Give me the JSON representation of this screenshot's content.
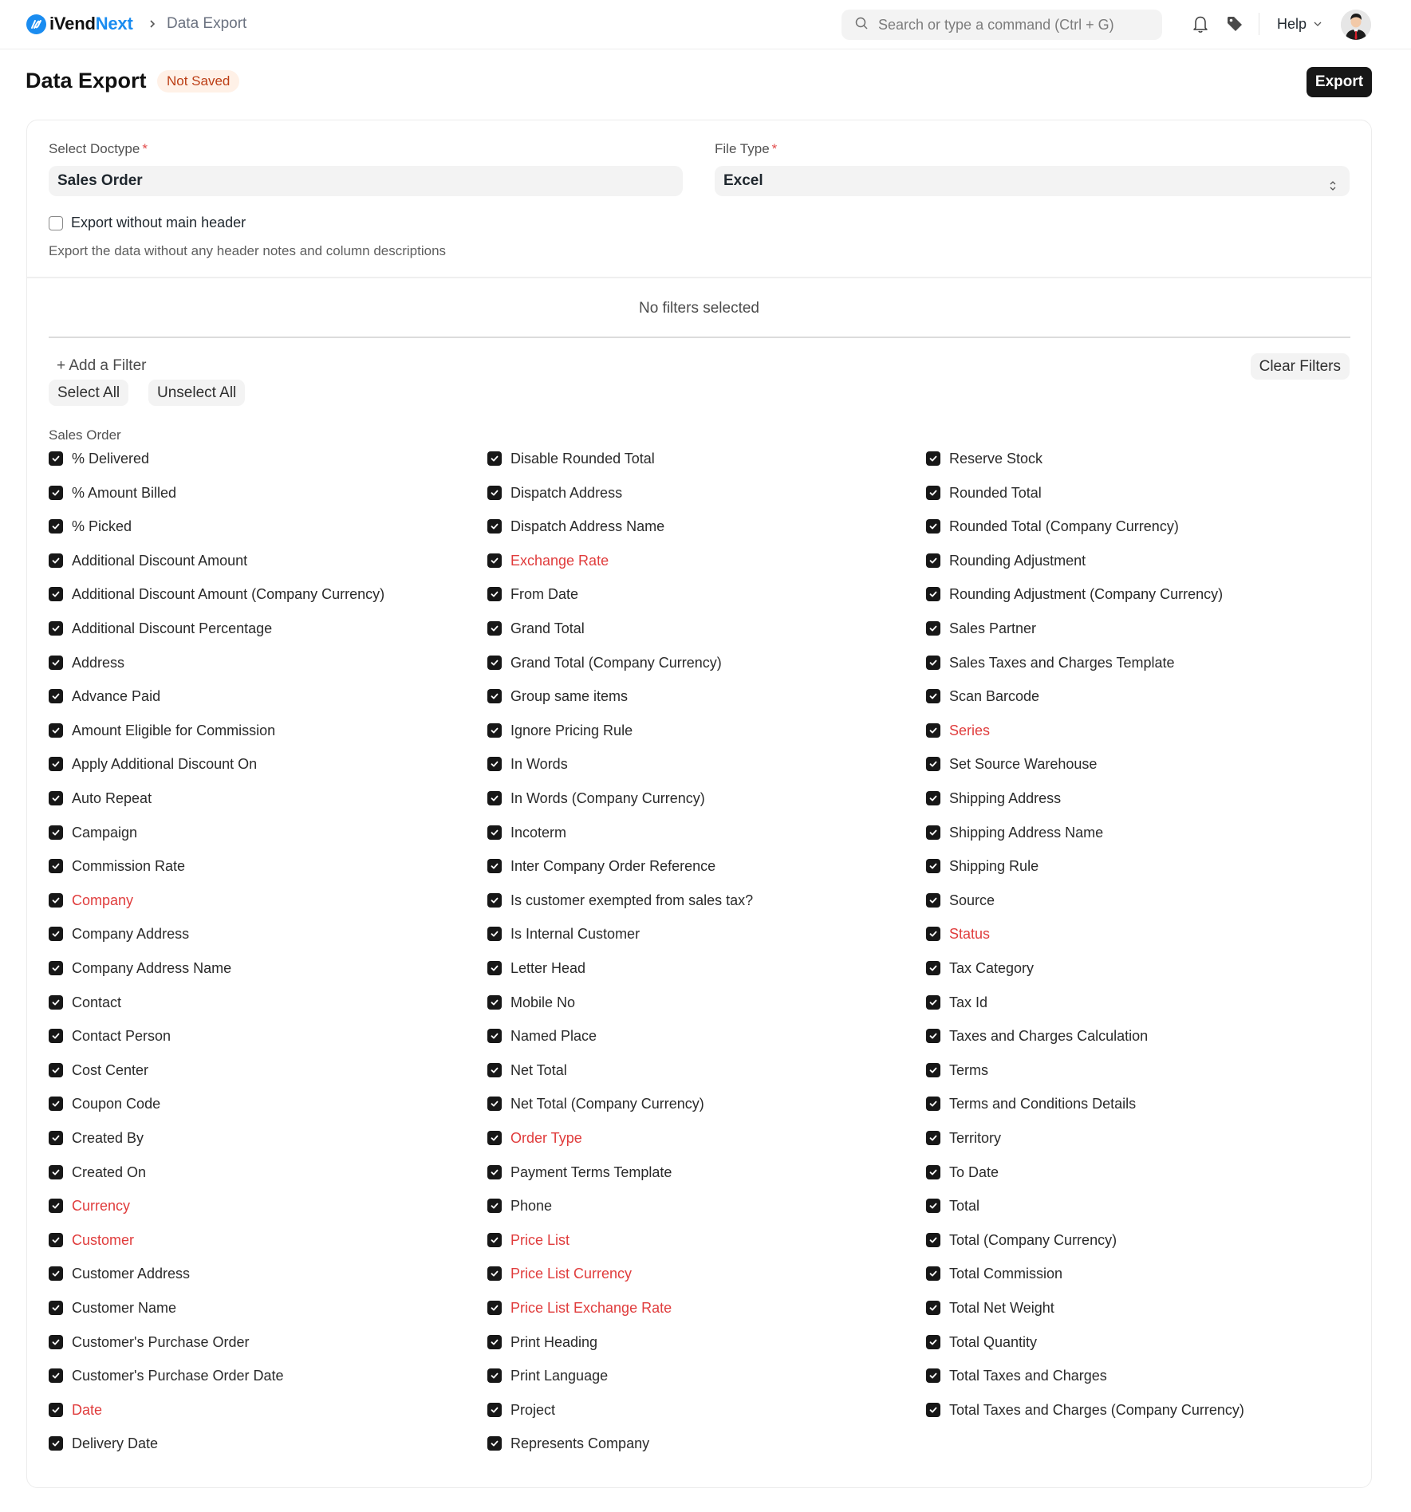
{
  "navbar": {
    "brand_prefix": "iVend",
    "brand_suffix": "Next",
    "breadcrumb": "Data Export",
    "search_placeholder": "Search or type a command (Ctrl + G)",
    "help_label": "Help",
    "icons": [
      "logo-icon",
      "chevron-right-icon",
      "search-icon",
      "bell-icon",
      "tag-icon",
      "chevron-down-icon",
      "avatar"
    ]
  },
  "page": {
    "title": "Data Export",
    "status_badge": "Not Saved",
    "export_label": "Export"
  },
  "form": {
    "doctype_label": "Select Doctype",
    "doctype_value": "Sales Order",
    "file_type_label": "File Type",
    "file_type_value": "Excel",
    "required_marker": "*",
    "export_without_header_label": "Export without main header",
    "export_without_header_checked": false,
    "export_without_header_description": "Export the data without any header notes and column descriptions"
  },
  "filters": {
    "empty_text": "No filters selected",
    "add_filter_label": "+ Add a Filter",
    "clear_filters_label": "Clear Filters",
    "select_all_label": "Select All",
    "unselect_all_label": "Unselect All"
  },
  "fields_section": {
    "label": "Sales Order",
    "columns": [
      [
        {
          "label": "% Delivered",
          "checked": true,
          "mandatory": false
        },
        {
          "label": "% Amount Billed",
          "checked": true,
          "mandatory": false
        },
        {
          "label": "% Picked",
          "checked": true,
          "mandatory": false
        },
        {
          "label": "Additional Discount Amount",
          "checked": true,
          "mandatory": false
        },
        {
          "label": "Additional Discount Amount (Company Currency)",
          "checked": true,
          "mandatory": false
        },
        {
          "label": "Additional Discount Percentage",
          "checked": true,
          "mandatory": false
        },
        {
          "label": "Address",
          "checked": true,
          "mandatory": false
        },
        {
          "label": "Advance Paid",
          "checked": true,
          "mandatory": false
        },
        {
          "label": "Amount Eligible for Commission",
          "checked": true,
          "mandatory": false
        },
        {
          "label": "Apply Additional Discount On",
          "checked": true,
          "mandatory": false
        },
        {
          "label": "Auto Repeat",
          "checked": true,
          "mandatory": false
        },
        {
          "label": "Campaign",
          "checked": true,
          "mandatory": false
        },
        {
          "label": "Commission Rate",
          "checked": true,
          "mandatory": false
        },
        {
          "label": "Company",
          "checked": true,
          "mandatory": true
        },
        {
          "label": "Company Address",
          "checked": true,
          "mandatory": false
        },
        {
          "label": "Company Address Name",
          "checked": true,
          "mandatory": false
        },
        {
          "label": "Contact",
          "checked": true,
          "mandatory": false
        },
        {
          "label": "Contact Person",
          "checked": true,
          "mandatory": false
        },
        {
          "label": "Cost Center",
          "checked": true,
          "mandatory": false
        },
        {
          "label": "Coupon Code",
          "checked": true,
          "mandatory": false
        },
        {
          "label": "Created By",
          "checked": true,
          "mandatory": false
        },
        {
          "label": "Created On",
          "checked": true,
          "mandatory": false
        },
        {
          "label": "Currency",
          "checked": true,
          "mandatory": true
        },
        {
          "label": "Customer",
          "checked": true,
          "mandatory": true
        },
        {
          "label": "Customer Address",
          "checked": true,
          "mandatory": false
        },
        {
          "label": "Customer Name",
          "checked": true,
          "mandatory": false
        },
        {
          "label": "Customer's Purchase Order",
          "checked": true,
          "mandatory": false
        },
        {
          "label": "Customer's Purchase Order Date",
          "checked": true,
          "mandatory": false
        },
        {
          "label": "Date",
          "checked": true,
          "mandatory": true
        },
        {
          "label": "Delivery Date",
          "checked": true,
          "mandatory": false
        }
      ],
      [
        {
          "label": "Disable Rounded Total",
          "checked": true,
          "mandatory": false
        },
        {
          "label": "Dispatch Address",
          "checked": true,
          "mandatory": false
        },
        {
          "label": "Dispatch Address Name",
          "checked": true,
          "mandatory": false
        },
        {
          "label": "Exchange Rate",
          "checked": true,
          "mandatory": true
        },
        {
          "label": "From Date",
          "checked": true,
          "mandatory": false
        },
        {
          "label": "Grand Total",
          "checked": true,
          "mandatory": false
        },
        {
          "label": "Grand Total (Company Currency)",
          "checked": true,
          "mandatory": false
        },
        {
          "label": "Group same items",
          "checked": true,
          "mandatory": false
        },
        {
          "label": "Ignore Pricing Rule",
          "checked": true,
          "mandatory": false
        },
        {
          "label": "In Words",
          "checked": true,
          "mandatory": false
        },
        {
          "label": "In Words (Company Currency)",
          "checked": true,
          "mandatory": false
        },
        {
          "label": "Incoterm",
          "checked": true,
          "mandatory": false
        },
        {
          "label": "Inter Company Order Reference",
          "checked": true,
          "mandatory": false
        },
        {
          "label": "Is customer exempted from sales tax?",
          "checked": true,
          "mandatory": false
        },
        {
          "label": "Is Internal Customer",
          "checked": true,
          "mandatory": false
        },
        {
          "label": "Letter Head",
          "checked": true,
          "mandatory": false
        },
        {
          "label": "Mobile No",
          "checked": true,
          "mandatory": false
        },
        {
          "label": "Named Place",
          "checked": true,
          "mandatory": false
        },
        {
          "label": "Net Total",
          "checked": true,
          "mandatory": false
        },
        {
          "label": "Net Total (Company Currency)",
          "checked": true,
          "mandatory": false
        },
        {
          "label": "Order Type",
          "checked": true,
          "mandatory": true
        },
        {
          "label": "Payment Terms Template",
          "checked": true,
          "mandatory": false
        },
        {
          "label": "Phone",
          "checked": true,
          "mandatory": false
        },
        {
          "label": "Price List",
          "checked": true,
          "mandatory": true
        },
        {
          "label": "Price List Currency",
          "checked": true,
          "mandatory": true
        },
        {
          "label": "Price List Exchange Rate",
          "checked": true,
          "mandatory": true
        },
        {
          "label": "Print Heading",
          "checked": true,
          "mandatory": false
        },
        {
          "label": "Print Language",
          "checked": true,
          "mandatory": false
        },
        {
          "label": "Project",
          "checked": true,
          "mandatory": false
        },
        {
          "label": "Represents Company",
          "checked": true,
          "mandatory": false
        }
      ],
      [
        {
          "label": "Reserve Stock",
          "checked": true,
          "mandatory": false
        },
        {
          "label": "Rounded Total",
          "checked": true,
          "mandatory": false
        },
        {
          "label": "Rounded Total (Company Currency)",
          "checked": true,
          "mandatory": false
        },
        {
          "label": "Rounding Adjustment",
          "checked": true,
          "mandatory": false
        },
        {
          "label": "Rounding Adjustment (Company Currency)",
          "checked": true,
          "mandatory": false
        },
        {
          "label": "Sales Partner",
          "checked": true,
          "mandatory": false
        },
        {
          "label": "Sales Taxes and Charges Template",
          "checked": true,
          "mandatory": false
        },
        {
          "label": "Scan Barcode",
          "checked": true,
          "mandatory": false
        },
        {
          "label": "Series",
          "checked": true,
          "mandatory": true
        },
        {
          "label": "Set Source Warehouse",
          "checked": true,
          "mandatory": false
        },
        {
          "label": "Shipping Address",
          "checked": true,
          "mandatory": false
        },
        {
          "label": "Shipping Address Name",
          "checked": true,
          "mandatory": false
        },
        {
          "label": "Shipping Rule",
          "checked": true,
          "mandatory": false
        },
        {
          "label": "Source",
          "checked": true,
          "mandatory": false
        },
        {
          "label": "Status",
          "checked": true,
          "mandatory": true
        },
        {
          "label": "Tax Category",
          "checked": true,
          "mandatory": false
        },
        {
          "label": "Tax Id",
          "checked": true,
          "mandatory": false
        },
        {
          "label": "Taxes and Charges Calculation",
          "checked": true,
          "mandatory": false
        },
        {
          "label": "Terms",
          "checked": true,
          "mandatory": false
        },
        {
          "label": "Terms and Conditions Details",
          "checked": true,
          "mandatory": false
        },
        {
          "label": "Territory",
          "checked": true,
          "mandatory": false
        },
        {
          "label": "To Date",
          "checked": true,
          "mandatory": false
        },
        {
          "label": "Total",
          "checked": true,
          "mandatory": false
        },
        {
          "label": "Total (Company Currency)",
          "checked": true,
          "mandatory": false
        },
        {
          "label": "Total Commission",
          "checked": true,
          "mandatory": false
        },
        {
          "label": "Total Net Weight",
          "checked": true,
          "mandatory": false
        },
        {
          "label": "Total Quantity",
          "checked": true,
          "mandatory": false
        },
        {
          "label": "Total Taxes and Charges",
          "checked": true,
          "mandatory": false
        },
        {
          "label": "Total Taxes and Charges (Company Currency)",
          "checked": true,
          "mandatory": false
        }
      ]
    ]
  },
  "colors": {
    "brand": "#1a8cf0",
    "primary_button": "#171717",
    "mandatory_text": "#e03c3c",
    "badge_bg": "#fff1e7",
    "badge_text": "#bc3e15"
  }
}
